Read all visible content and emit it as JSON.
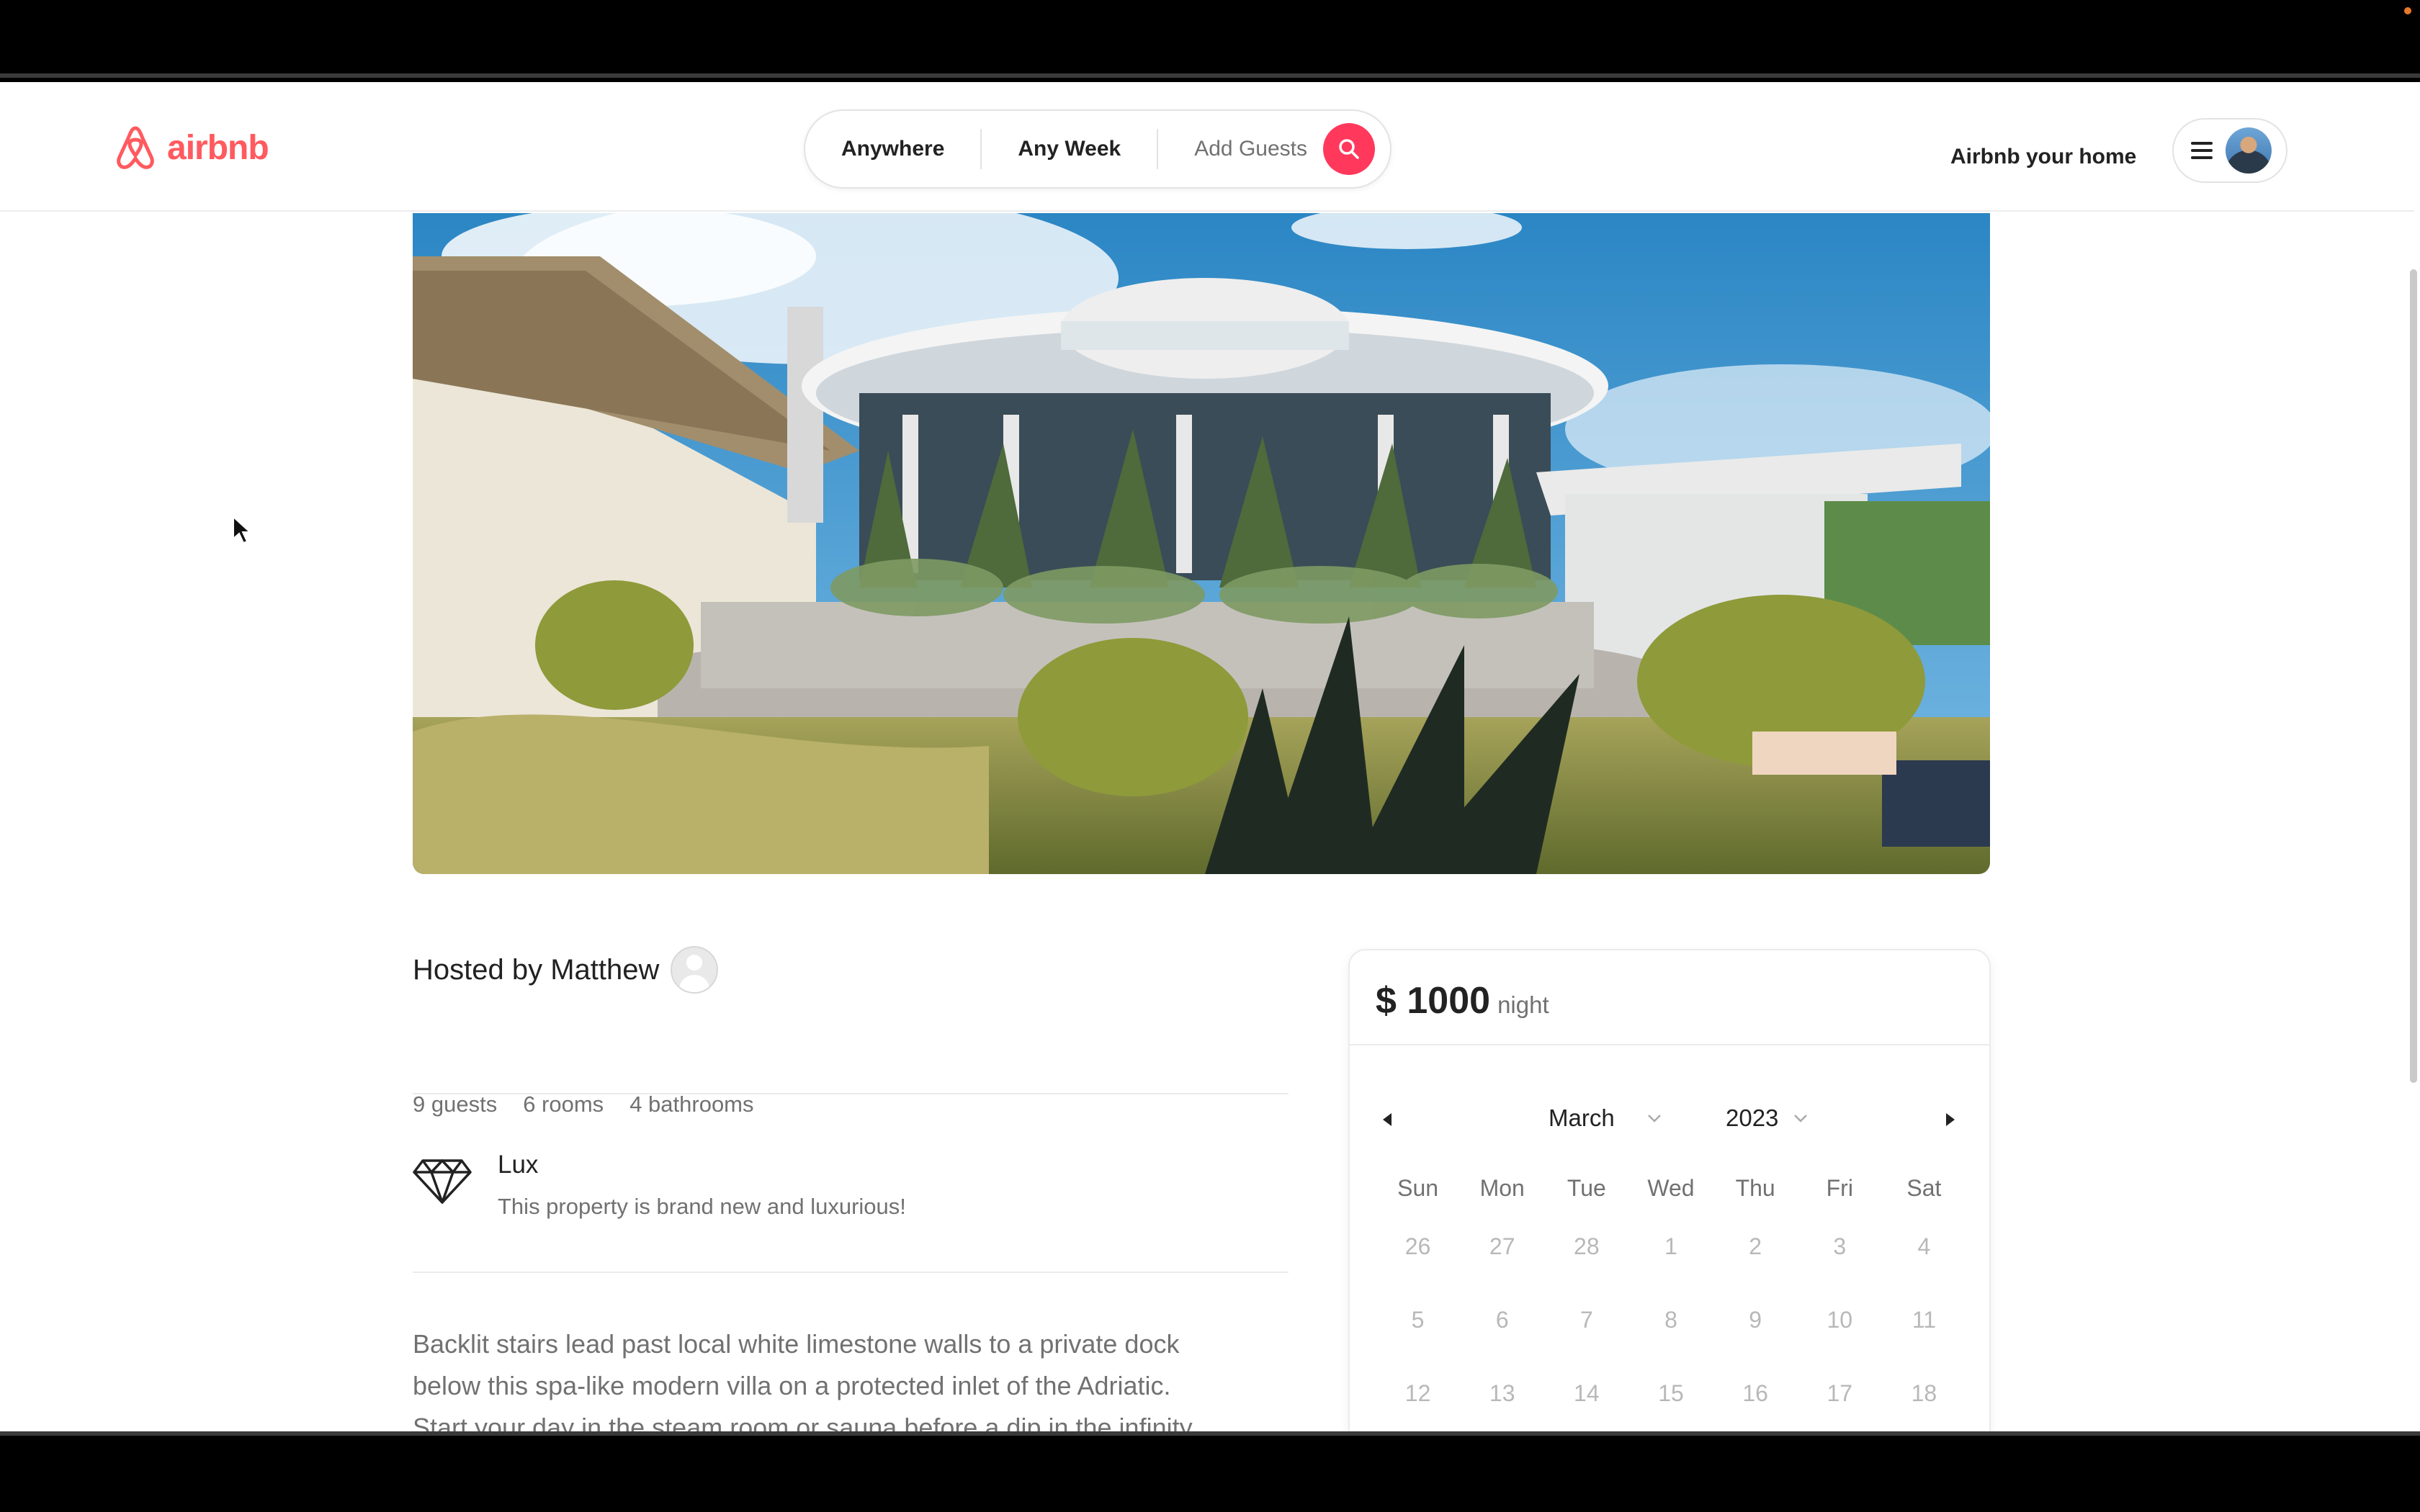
{
  "header": {
    "logo_text": "airbnb",
    "search": {
      "location": "Anywhere",
      "dates": "Any Week",
      "guests": "Add Guests"
    },
    "host_link": "Airbnb your home"
  },
  "colors": {
    "brand": "#ff5a5f",
    "search_button": "#ff385c"
  },
  "listing": {
    "hosted_by": "Hosted by Matthew",
    "stats": [
      "9 guests",
      "6 rooms",
      "4 bathrooms"
    ],
    "feature": {
      "icon": "diamond-icon",
      "title": "Lux",
      "description": "This property is brand new and luxurious!"
    },
    "description_lines": [
      "Backlit stairs lead past local white limestone walls to a private dock",
      "below this spa-like modern villa on a protected inlet of the Adriatic.",
      "Start your day in the steam room or sauna before a dip in the infinity"
    ]
  },
  "booking": {
    "currency": "$",
    "price": "1000",
    "price_unit": "night",
    "calendar": {
      "month": "March",
      "year": "2023",
      "weekdays": [
        "Sun",
        "Mon",
        "Tue",
        "Wed",
        "Thu",
        "Fri",
        "Sat"
      ],
      "days": [
        "26",
        "27",
        "28",
        "1",
        "2",
        "3",
        "4",
        "5",
        "6",
        "7",
        "8",
        "9",
        "10",
        "11",
        "12",
        "13",
        "14",
        "15",
        "16",
        "17",
        "18"
      ]
    }
  }
}
